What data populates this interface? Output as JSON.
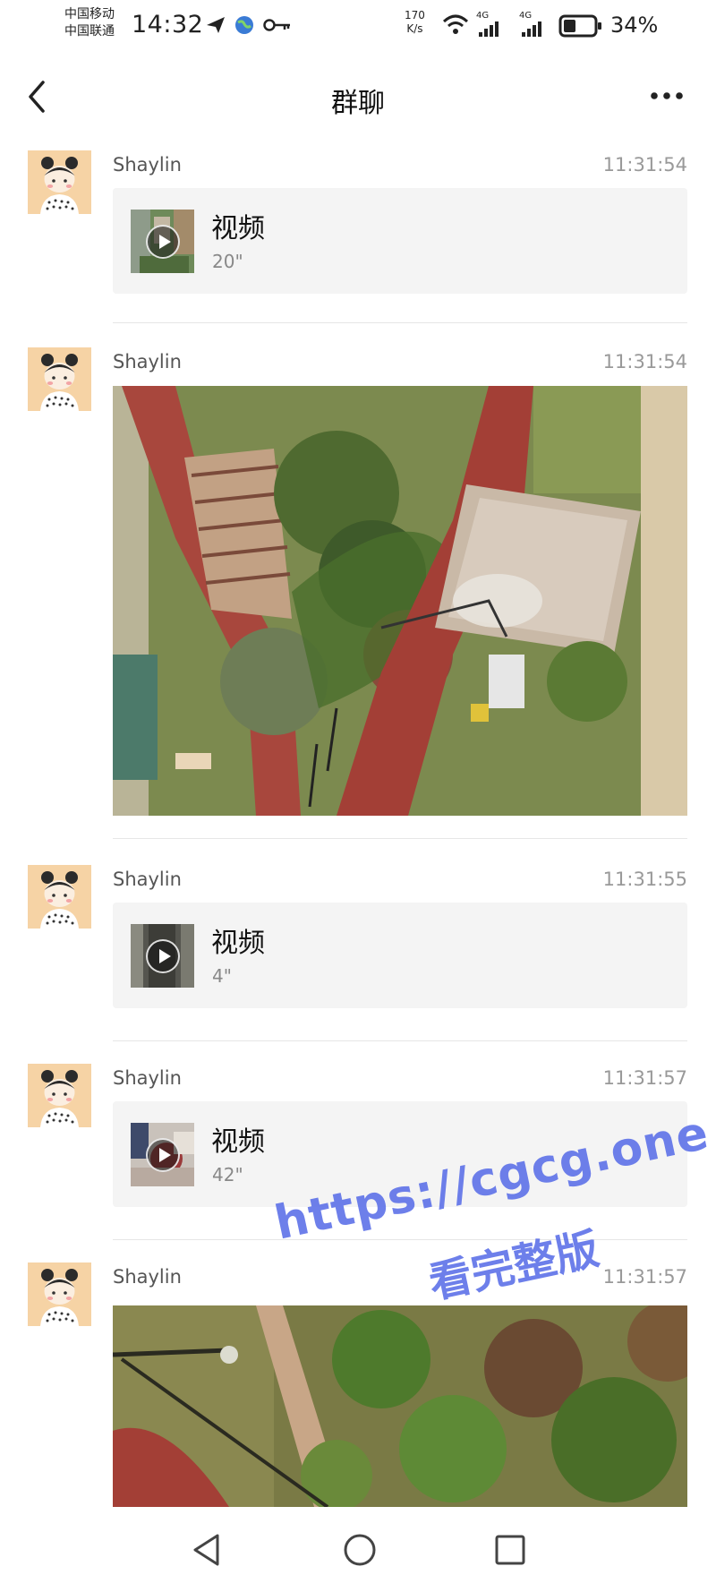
{
  "status_bar": {
    "carrier_1": "中国移动",
    "carrier_2": "中国联通",
    "time": "14:32",
    "speed_value": "170",
    "speed_unit": "K/s",
    "net_1": "4G",
    "net_2": "4G",
    "battery": "34%"
  },
  "header": {
    "title": "群聊"
  },
  "messages": [
    {
      "sender": "Shaylin",
      "time": "11:31:54",
      "type": "video",
      "label": "视频",
      "duration": "20\""
    },
    {
      "sender": "Shaylin",
      "time": "11:31:54",
      "type": "image"
    },
    {
      "sender": "Shaylin",
      "time": "11:31:55",
      "type": "video",
      "label": "视频",
      "duration": "4\""
    },
    {
      "sender": "Shaylin",
      "time": "11:31:57",
      "type": "video",
      "label": "视频",
      "duration": "42\""
    },
    {
      "sender": "Shaylin",
      "time": "11:31:57",
      "type": "image"
    }
  ],
  "watermark": {
    "line1": "https://cgcg.one",
    "line2": "看完整版"
  },
  "icons": [
    "back-arrow-icon",
    "more-dots-icon",
    "send-icon",
    "globe-icon",
    "key-icon",
    "wifi-icon",
    "signal-icon",
    "battery-icon",
    "nav-back-triangle-icon",
    "nav-home-circle-icon",
    "nav-recent-square-icon",
    "video-play-icon"
  ],
  "colors": {
    "avatar_bg": "#f6d3a5",
    "card_bg": "#f4f4f4",
    "watermark": "#5a6ee8"
  }
}
